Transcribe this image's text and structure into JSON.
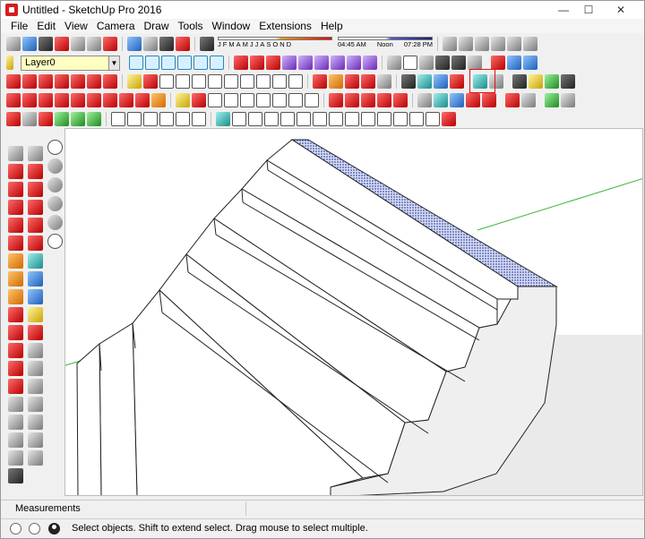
{
  "window": {
    "title": "Untitled - SketchUp Pro 2016",
    "minimize_glyph": "—",
    "maximize_glyph": "☐",
    "close_glyph": "✕"
  },
  "menu": {
    "items": [
      "File",
      "Edit",
      "View",
      "Camera",
      "Draw",
      "Tools",
      "Window",
      "Extensions",
      "Help"
    ]
  },
  "layer": {
    "current": "Layer0"
  },
  "shadows": {
    "months": [
      "J",
      "F",
      "M",
      "A",
      "M",
      "J",
      "J",
      "A",
      "S",
      "O",
      "N",
      "D"
    ],
    "time_start": "04:45 AM",
    "time_mid": "Noon",
    "time_end": "07:28 PM"
  },
  "measurements": {
    "label": "Measurements",
    "value": ""
  },
  "status": {
    "message": "Select objects. Shift to extend select. Drag mouse to select multiple."
  },
  "colors": {
    "accent_highlight": "#e01010",
    "axis_green": "#3cb33c",
    "selection_blue": "#3a4fb0"
  }
}
